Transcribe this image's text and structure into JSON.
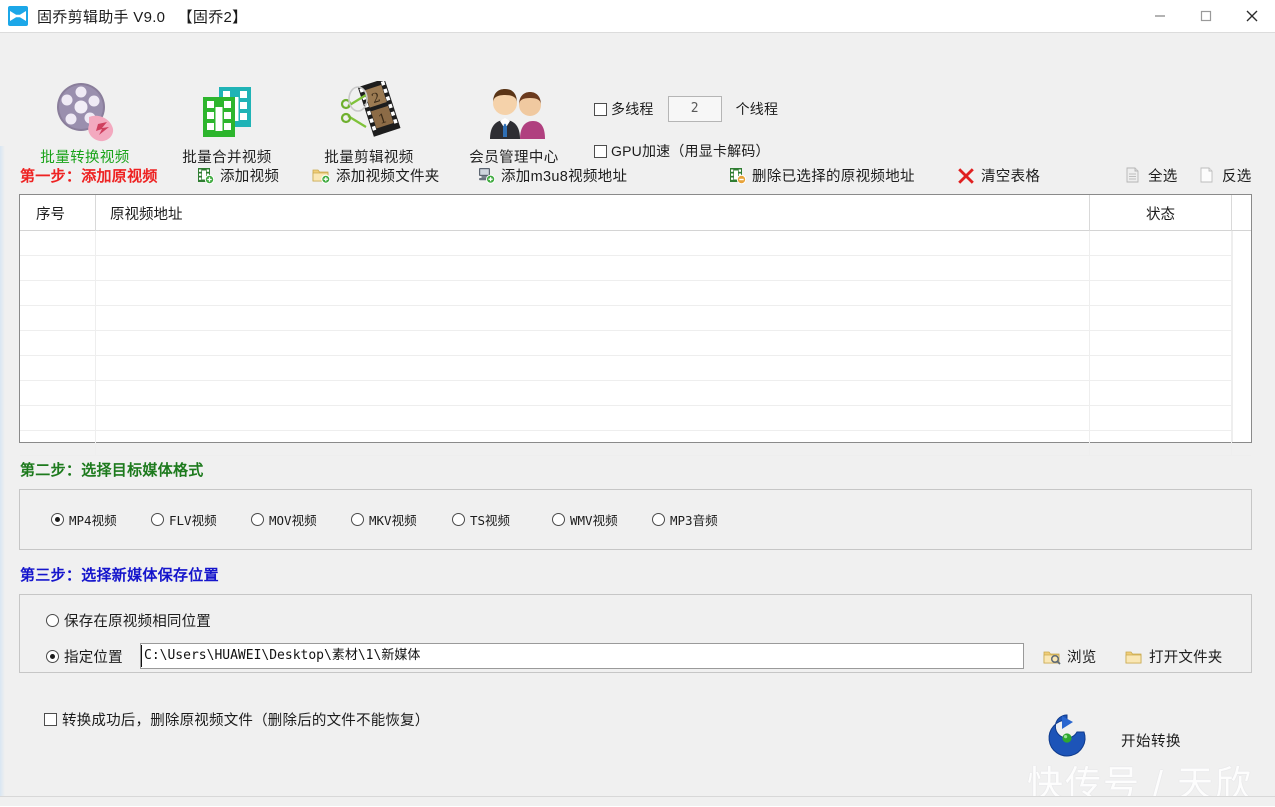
{
  "window": {
    "title": "固乔剪辑助手 V9.0 　【固乔2】",
    "app_icon": "bowtie-app-icon",
    "controls": {
      "minimize": "minimize-icon",
      "maximize": "maximize-icon",
      "close": "close-icon"
    }
  },
  "toolbar": {
    "items": [
      {
        "label": "批量转换视频",
        "icon": "film-reel-icon",
        "active": true
      },
      {
        "label": "批量合并视频",
        "icon": "merge-video-icon",
        "active": false
      },
      {
        "label": "批量剪辑视频",
        "icon": "film-strip-scissors-icon",
        "active": false
      },
      {
        "label": "会员管理中心",
        "icon": "members-icon",
        "active": false
      }
    ],
    "options": {
      "multithread_label": "多线程",
      "thread_count": "2",
      "thread_unit_label": "个线程",
      "gpu_label": "GPU加速（用显卡解码）",
      "multithread_checked": false,
      "gpu_checked": false
    }
  },
  "step1": {
    "title": "第一步：添加原视频",
    "title_color": "#ee2222",
    "actions": [
      {
        "label": "添加视频",
        "icon": "add-video-icon"
      },
      {
        "label": "添加视频文件夹",
        "icon": "add-folder-icon"
      },
      {
        "label": "添加m3u8视频地址",
        "icon": "add-m3u8-icon"
      },
      {
        "label": "删除已选择的原视频地址",
        "icon": "remove-video-icon"
      },
      {
        "label": "清空表格",
        "icon": "clear-table-icon"
      },
      {
        "label": "全选",
        "icon": "select-all-icon"
      },
      {
        "label": "反选",
        "icon": "invert-selection-icon"
      }
    ]
  },
  "table": {
    "columns": [
      "序号",
      "原视频地址",
      "状态"
    ],
    "rows": [],
    "empty_row_count": 9
  },
  "step2": {
    "title": "第二步：选择目标媒体格式",
    "title_color": "#1d7a1d",
    "formats": [
      {
        "label": "MP4视频",
        "selected": true
      },
      {
        "label": "FLV视频",
        "selected": false
      },
      {
        "label": "MOV视频",
        "selected": false
      },
      {
        "label": "MKV视频",
        "selected": false
      },
      {
        "label": "TS视频",
        "selected": false
      },
      {
        "label": "WMV视频",
        "selected": false
      },
      {
        "label": "MP3音频",
        "selected": false
      }
    ]
  },
  "step3": {
    "title": "第三步：选择新媒体保存位置",
    "title_color": "#1515cc",
    "option_same": {
      "label": "保存在原视频相同位置",
      "selected": false
    },
    "option_custom": {
      "label": "指定位置",
      "selected": true
    },
    "path_value": "C:\\Users\\HUAWEI\\Desktop\\素材\\1\\新媒体",
    "browse_label": "浏览",
    "browse_icon": "folder-search-icon",
    "open_folder_label": "打开文件夹",
    "open_folder_icon": "folder-icon"
  },
  "bottom": {
    "delete_after_label": "转换成功后，删除原视频文件（删除后的文件不能恢复）",
    "delete_after_checked": false,
    "start_label": "开始转换",
    "start_icon": "refresh-circle-icon",
    "watermark": "快传号 / 天欣"
  }
}
